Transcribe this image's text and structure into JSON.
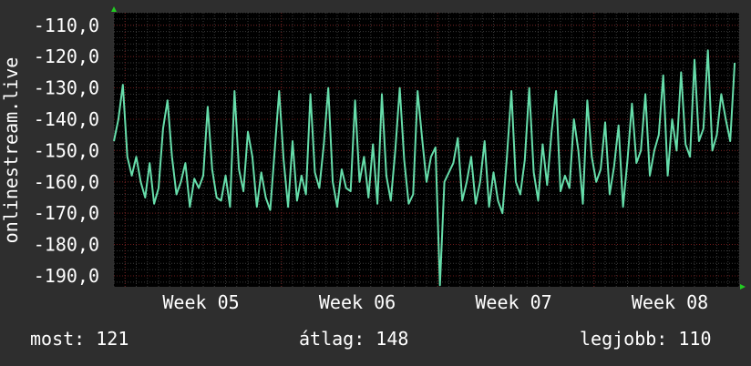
{
  "colors": {
    "background": "#2e2e2e",
    "plot_background": "#000000",
    "grid_minor": "#3a3a3a",
    "grid_major": "#6e1a1a",
    "line": "#66ddaa",
    "text": "#ffffff",
    "axis_arrow": "#22cc22"
  },
  "stats": {
    "current": "most: 121",
    "average": "átlag: 148",
    "best": "legjobb: 110"
  },
  "chart_data": {
    "type": "line",
    "ylabel": "onlinestream.live",
    "xlabel": "",
    "title": "",
    "ylim": [
      -193.5,
      -106
    ],
    "yticks": [
      -110,
      -120,
      -130,
      -140,
      -150,
      -160,
      -170,
      -180,
      -190
    ],
    "ytick_labels": [
      "-110,0",
      "-120,0",
      "-130,0",
      "-140,0",
      "-150,0",
      "-160,0",
      "-170,0",
      "-180,0",
      "-190,0"
    ],
    "xlim": [
      0,
      28
    ],
    "xticks": [
      {
        "x": 3.9,
        "label": "Week 05"
      },
      {
        "x": 10.9,
        "label": "Week 06"
      },
      {
        "x": 17.9,
        "label": "Week 07"
      },
      {
        "x": 24.9,
        "label": "Week 08"
      }
    ],
    "x_major_grid": [
      0.5,
      7.5,
      14.5,
      21.5
    ],
    "grid": true,
    "series": [
      {
        "values": [
          [
            0.0,
            -147
          ],
          [
            0.2,
            -140
          ],
          [
            0.4,
            -129
          ],
          [
            0.6,
            -152
          ],
          [
            0.8,
            -158
          ],
          [
            1.0,
            -152
          ],
          [
            1.2,
            -160
          ],
          [
            1.4,
            -165
          ],
          [
            1.6,
            -154
          ],
          [
            1.8,
            -167
          ],
          [
            2.0,
            -162
          ],
          [
            2.2,
            -143
          ],
          [
            2.4,
            -134
          ],
          [
            2.6,
            -152
          ],
          [
            2.8,
            -164
          ],
          [
            3.0,
            -160
          ],
          [
            3.2,
            -154
          ],
          [
            3.4,
            -168
          ],
          [
            3.6,
            -159
          ],
          [
            3.8,
            -162
          ],
          [
            4.0,
            -158
          ],
          [
            4.2,
            -136
          ],
          [
            4.4,
            -156
          ],
          [
            4.6,
            -165
          ],
          [
            4.8,
            -166
          ],
          [
            5.0,
            -158
          ],
          [
            5.2,
            -168
          ],
          [
            5.4,
            -131
          ],
          [
            5.6,
            -156
          ],
          [
            5.8,
            -163
          ],
          [
            6.0,
            -144
          ],
          [
            6.2,
            -152
          ],
          [
            6.4,
            -168
          ],
          [
            6.6,
            -157
          ],
          [
            6.8,
            -165
          ],
          [
            7.0,
            -169
          ],
          [
            7.2,
            -150
          ],
          [
            7.4,
            -131
          ],
          [
            7.6,
            -153
          ],
          [
            7.8,
            -168
          ],
          [
            8.0,
            -147
          ],
          [
            8.2,
            -166
          ],
          [
            8.4,
            -158
          ],
          [
            8.6,
            -164
          ],
          [
            8.8,
            -132
          ],
          [
            9.0,
            -157
          ],
          [
            9.2,
            -162
          ],
          [
            9.4,
            -148
          ],
          [
            9.6,
            -130
          ],
          [
            9.8,
            -160
          ],
          [
            10.0,
            -168
          ],
          [
            10.2,
            -156
          ],
          [
            10.4,
            -162
          ],
          [
            10.6,
            -163
          ],
          [
            10.8,
            -134
          ],
          [
            11.0,
            -160
          ],
          [
            11.2,
            -152
          ],
          [
            11.4,
            -165
          ],
          [
            11.6,
            -148
          ],
          [
            11.8,
            -167
          ],
          [
            12.0,
            -132
          ],
          [
            12.2,
            -158
          ],
          [
            12.4,
            -166
          ],
          [
            12.6,
            -150
          ],
          [
            12.8,
            -130
          ],
          [
            13.0,
            -153
          ],
          [
            13.2,
            -167
          ],
          [
            13.4,
            -164
          ],
          [
            13.6,
            -131
          ],
          [
            13.8,
            -146
          ],
          [
            14.0,
            -160
          ],
          [
            14.2,
            -152
          ],
          [
            14.4,
            -149
          ],
          [
            14.6,
            -193
          ],
          [
            14.8,
            -160
          ],
          [
            15.0,
            -157
          ],
          [
            15.2,
            -154
          ],
          [
            15.4,
            -146
          ],
          [
            15.6,
            -166
          ],
          [
            15.8,
            -160
          ],
          [
            16.0,
            -152
          ],
          [
            16.2,
            -167
          ],
          [
            16.4,
            -160
          ],
          [
            16.6,
            -147
          ],
          [
            16.8,
            -168
          ],
          [
            17.0,
            -157
          ],
          [
            17.2,
            -166
          ],
          [
            17.4,
            -170
          ],
          [
            17.6,
            -152
          ],
          [
            17.8,
            -131
          ],
          [
            18.0,
            -160
          ],
          [
            18.2,
            -164
          ],
          [
            18.4,
            -153
          ],
          [
            18.6,
            -130
          ],
          [
            18.8,
            -157
          ],
          [
            19.0,
            -166
          ],
          [
            19.2,
            -148
          ],
          [
            19.4,
            -161
          ],
          [
            19.6,
            -144
          ],
          [
            19.8,
            -131
          ],
          [
            20.0,
            -163
          ],
          [
            20.2,
            -158
          ],
          [
            20.4,
            -162
          ],
          [
            20.6,
            -140
          ],
          [
            20.8,
            -150
          ],
          [
            21.0,
            -167
          ],
          [
            21.2,
            -134
          ],
          [
            21.4,
            -152
          ],
          [
            21.6,
            -160
          ],
          [
            21.8,
            -156
          ],
          [
            22.0,
            -141
          ],
          [
            22.2,
            -164
          ],
          [
            22.4,
            -155
          ],
          [
            22.6,
            -142
          ],
          [
            22.8,
            -168
          ],
          [
            23.0,
            -153
          ],
          [
            23.2,
            -135
          ],
          [
            23.4,
            -154
          ],
          [
            23.6,
            -150
          ],
          [
            23.8,
            -132
          ],
          [
            24.0,
            -158
          ],
          [
            24.2,
            -150
          ],
          [
            24.4,
            -145
          ],
          [
            24.6,
            -126
          ],
          [
            24.8,
            -158
          ],
          [
            25.0,
            -140
          ],
          [
            25.2,
            -150
          ],
          [
            25.4,
            -125
          ],
          [
            25.6,
            -148
          ],
          [
            25.8,
            -152
          ],
          [
            26.0,
            -121
          ],
          [
            26.2,
            -147
          ],
          [
            26.4,
            -143
          ],
          [
            26.6,
            -118
          ],
          [
            26.8,
            -150
          ],
          [
            27.0,
            -145
          ],
          [
            27.2,
            -132
          ],
          [
            27.4,
            -140
          ],
          [
            27.6,
            -147
          ],
          [
            27.8,
            -122
          ]
        ]
      }
    ]
  }
}
